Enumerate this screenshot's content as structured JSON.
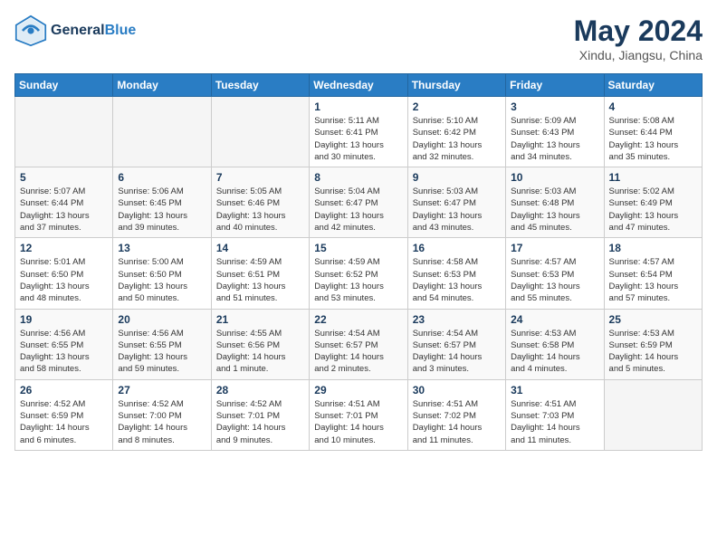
{
  "header": {
    "logo_line1": "General",
    "logo_line2": "Blue",
    "month": "May 2024",
    "location": "Xindu, Jiangsu, China"
  },
  "weekdays": [
    "Sunday",
    "Monday",
    "Tuesday",
    "Wednesday",
    "Thursday",
    "Friday",
    "Saturday"
  ],
  "weeks": [
    [
      {
        "day": "",
        "info": ""
      },
      {
        "day": "",
        "info": ""
      },
      {
        "day": "",
        "info": ""
      },
      {
        "day": "1",
        "info": "Sunrise: 5:11 AM\nSunset: 6:41 PM\nDaylight: 13 hours\nand 30 minutes."
      },
      {
        "day": "2",
        "info": "Sunrise: 5:10 AM\nSunset: 6:42 PM\nDaylight: 13 hours\nand 32 minutes."
      },
      {
        "day": "3",
        "info": "Sunrise: 5:09 AM\nSunset: 6:43 PM\nDaylight: 13 hours\nand 34 minutes."
      },
      {
        "day": "4",
        "info": "Sunrise: 5:08 AM\nSunset: 6:44 PM\nDaylight: 13 hours\nand 35 minutes."
      }
    ],
    [
      {
        "day": "5",
        "info": "Sunrise: 5:07 AM\nSunset: 6:44 PM\nDaylight: 13 hours\nand 37 minutes."
      },
      {
        "day": "6",
        "info": "Sunrise: 5:06 AM\nSunset: 6:45 PM\nDaylight: 13 hours\nand 39 minutes."
      },
      {
        "day": "7",
        "info": "Sunrise: 5:05 AM\nSunset: 6:46 PM\nDaylight: 13 hours\nand 40 minutes."
      },
      {
        "day": "8",
        "info": "Sunrise: 5:04 AM\nSunset: 6:47 PM\nDaylight: 13 hours\nand 42 minutes."
      },
      {
        "day": "9",
        "info": "Sunrise: 5:03 AM\nSunset: 6:47 PM\nDaylight: 13 hours\nand 43 minutes."
      },
      {
        "day": "10",
        "info": "Sunrise: 5:03 AM\nSunset: 6:48 PM\nDaylight: 13 hours\nand 45 minutes."
      },
      {
        "day": "11",
        "info": "Sunrise: 5:02 AM\nSunset: 6:49 PM\nDaylight: 13 hours\nand 47 minutes."
      }
    ],
    [
      {
        "day": "12",
        "info": "Sunrise: 5:01 AM\nSunset: 6:50 PM\nDaylight: 13 hours\nand 48 minutes."
      },
      {
        "day": "13",
        "info": "Sunrise: 5:00 AM\nSunset: 6:50 PM\nDaylight: 13 hours\nand 50 minutes."
      },
      {
        "day": "14",
        "info": "Sunrise: 4:59 AM\nSunset: 6:51 PM\nDaylight: 13 hours\nand 51 minutes."
      },
      {
        "day": "15",
        "info": "Sunrise: 4:59 AM\nSunset: 6:52 PM\nDaylight: 13 hours\nand 53 minutes."
      },
      {
        "day": "16",
        "info": "Sunrise: 4:58 AM\nSunset: 6:53 PM\nDaylight: 13 hours\nand 54 minutes."
      },
      {
        "day": "17",
        "info": "Sunrise: 4:57 AM\nSunset: 6:53 PM\nDaylight: 13 hours\nand 55 minutes."
      },
      {
        "day": "18",
        "info": "Sunrise: 4:57 AM\nSunset: 6:54 PM\nDaylight: 13 hours\nand 57 minutes."
      }
    ],
    [
      {
        "day": "19",
        "info": "Sunrise: 4:56 AM\nSunset: 6:55 PM\nDaylight: 13 hours\nand 58 minutes."
      },
      {
        "day": "20",
        "info": "Sunrise: 4:56 AM\nSunset: 6:55 PM\nDaylight: 13 hours\nand 59 minutes."
      },
      {
        "day": "21",
        "info": "Sunrise: 4:55 AM\nSunset: 6:56 PM\nDaylight: 14 hours\nand 1 minute."
      },
      {
        "day": "22",
        "info": "Sunrise: 4:54 AM\nSunset: 6:57 PM\nDaylight: 14 hours\nand 2 minutes."
      },
      {
        "day": "23",
        "info": "Sunrise: 4:54 AM\nSunset: 6:57 PM\nDaylight: 14 hours\nand 3 minutes."
      },
      {
        "day": "24",
        "info": "Sunrise: 4:53 AM\nSunset: 6:58 PM\nDaylight: 14 hours\nand 4 minutes."
      },
      {
        "day": "25",
        "info": "Sunrise: 4:53 AM\nSunset: 6:59 PM\nDaylight: 14 hours\nand 5 minutes."
      }
    ],
    [
      {
        "day": "26",
        "info": "Sunrise: 4:52 AM\nSunset: 6:59 PM\nDaylight: 14 hours\nand 6 minutes."
      },
      {
        "day": "27",
        "info": "Sunrise: 4:52 AM\nSunset: 7:00 PM\nDaylight: 14 hours\nand 8 minutes."
      },
      {
        "day": "28",
        "info": "Sunrise: 4:52 AM\nSunset: 7:01 PM\nDaylight: 14 hours\nand 9 minutes."
      },
      {
        "day": "29",
        "info": "Sunrise: 4:51 AM\nSunset: 7:01 PM\nDaylight: 14 hours\nand 10 minutes."
      },
      {
        "day": "30",
        "info": "Sunrise: 4:51 AM\nSunset: 7:02 PM\nDaylight: 14 hours\nand 11 minutes."
      },
      {
        "day": "31",
        "info": "Sunrise: 4:51 AM\nSunset: 7:03 PM\nDaylight: 14 hours\nand 11 minutes."
      },
      {
        "day": "",
        "info": ""
      }
    ]
  ]
}
